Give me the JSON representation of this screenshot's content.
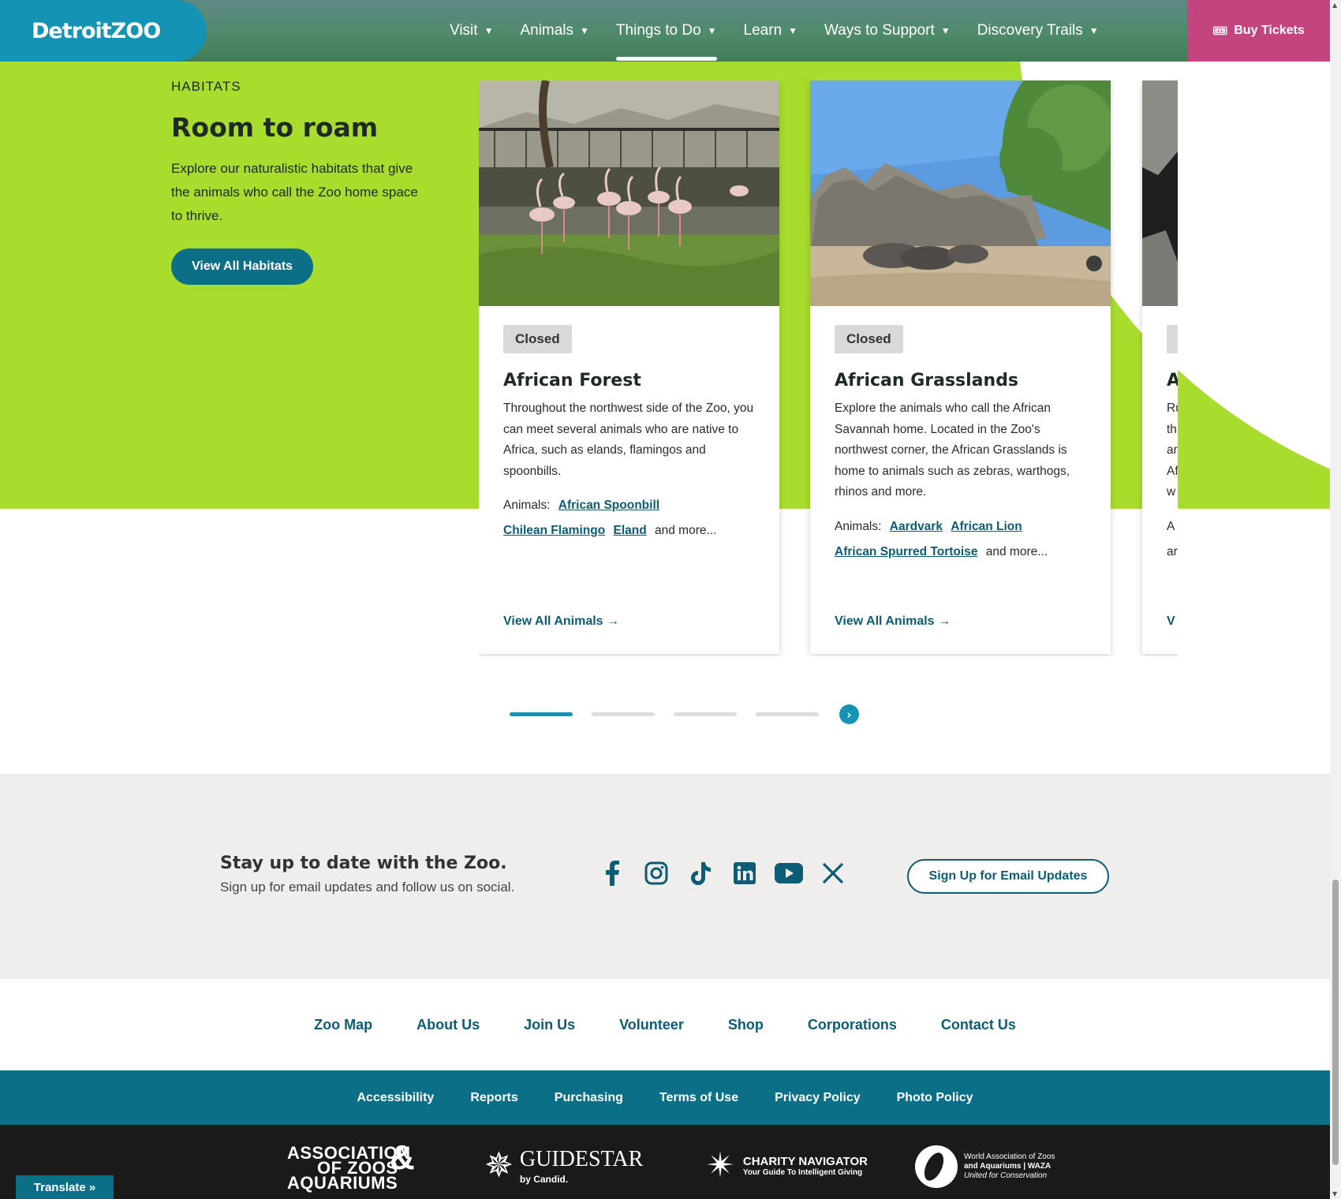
{
  "header": {
    "logo": "DetroitZOO",
    "nav": [
      {
        "label": "Visit"
      },
      {
        "label": "Animals"
      },
      {
        "label": "Things to Do"
      },
      {
        "label": "Learn"
      },
      {
        "label": "Ways to Support"
      },
      {
        "label": "Discovery Trails"
      }
    ],
    "active_nav": "Things to Do",
    "buy_tickets": "Buy Tickets"
  },
  "habitats": {
    "eyebrow": "HABITATS",
    "title": "Room to roam",
    "description": "Explore our naturalistic habitats that give the animals who call the Zoo home space to thrive.",
    "button": "View All Habitats",
    "cards": [
      {
        "status": "Closed",
        "title": "African Forest",
        "description": "Throughout the northwest side of the Zoo, you can meet several animals who are native to Africa, such as elands, flamingos and spoonbills.",
        "animals_label": "Animals:",
        "animals": [
          "African Spoonbill",
          "Chilean Flamingo",
          "Eland"
        ],
        "more": "and more...",
        "view_all": "View All Animals"
      },
      {
        "status": "Closed",
        "title": "African Grasslands",
        "description": "Explore the animals who call the African Savannah home. Located in the Zoo's northwest corner, the African Grasslands is home to animals such as zebras, warthogs, rhinos and more.",
        "animals_label": "Animals:",
        "animals": [
          "Aardvark",
          "African Lion",
          "African Spurred Tortoise"
        ],
        "more": "and more...",
        "view_all": "View All Animals"
      },
      {
        "title_partial": "A",
        "lines_partial": [
          "Ru",
          "th",
          "ar",
          "Af",
          "w"
        ],
        "animals_partial": [
          "A",
          "ar"
        ],
        "view_partial": "V"
      }
    ],
    "carousel": {
      "pages": 4,
      "current": 1
    }
  },
  "newsletter": {
    "title": "Stay up to date with the Zoo.",
    "subtitle": "Sign up for email updates and follow us on social.",
    "socials": [
      "facebook-icon",
      "instagram-icon",
      "tiktok-icon",
      "linkedin-icon",
      "youtube-icon",
      "x-icon"
    ],
    "button": "Sign Up for Email Updates"
  },
  "footer": {
    "links": [
      "Zoo Map",
      "About Us",
      "Join Us",
      "Volunteer",
      "Shop",
      "Corporations",
      "Contact Us"
    ],
    "legal": [
      "Accessibility",
      "Reports",
      "Purchasing",
      "Terms of Use",
      "Privacy Policy",
      "Photo Policy"
    ],
    "partners": {
      "aza": [
        "ASSOCIATION",
        "OF ZOOS",
        "AQUARIUMS",
        "&"
      ],
      "guidestar": [
        "GUIDESTAR",
        "by Candid."
      ],
      "charity": [
        "CHARITY NAVIGATOR",
        "Your Guide To Intelligent Giving"
      ],
      "waza": [
        "World Association of Zoos",
        "and Aquariums | WAZA",
        "United for Conservation"
      ]
    }
  },
  "translate": "Translate »",
  "colors": {
    "green": "#a8dd2e",
    "teal": "#0c6f88",
    "brand_blue": "#1493b4",
    "pink": "#c3447f"
  }
}
